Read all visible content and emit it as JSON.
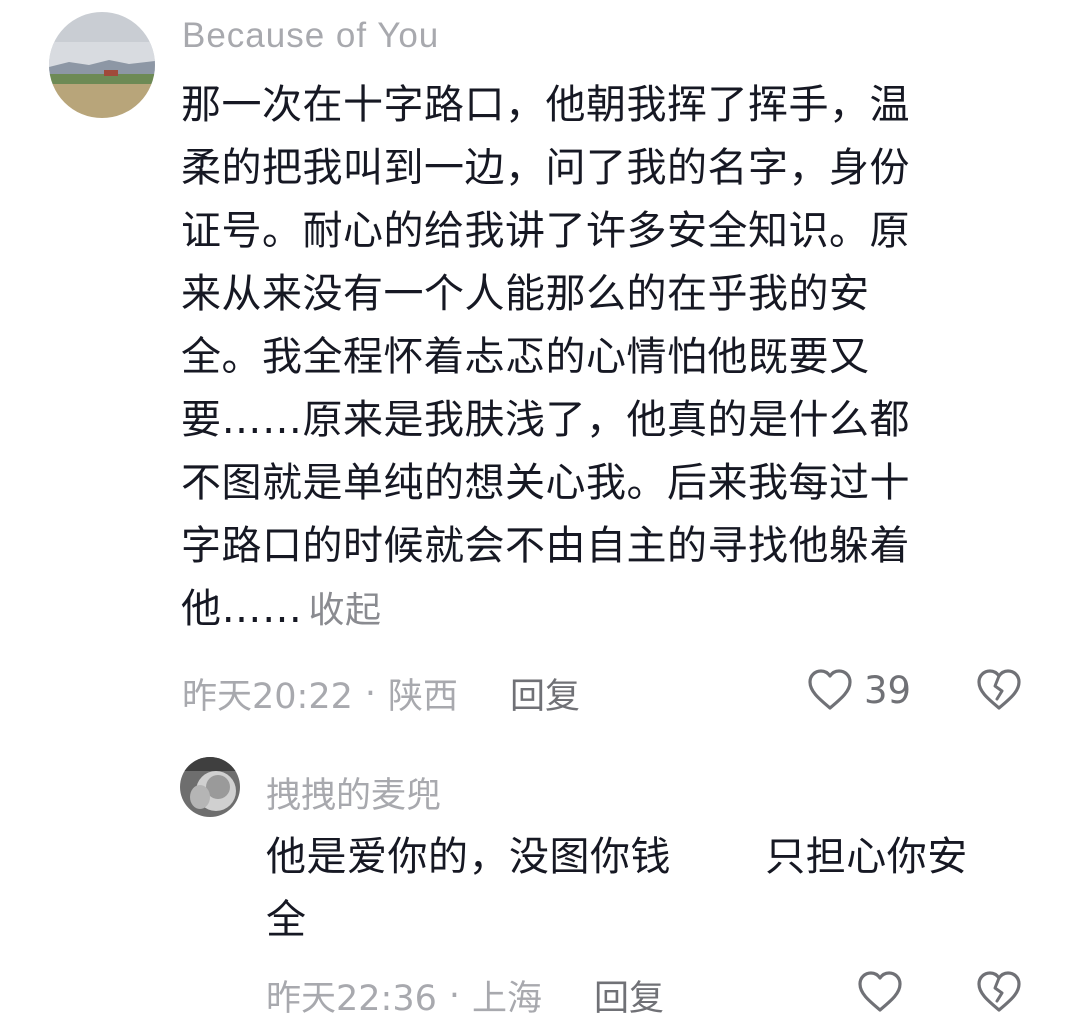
{
  "comments": [
    {
      "username": "Because  of  You",
      "lines": [
        "那一次在十字路口，他朝我挥了挥手，温",
        "柔的把我叫到一边，问了我的名字，身份",
        "证号。耐心的给我讲了许多安全知识。原",
        "来从来没有一个人能那么的在乎我的安",
        "全。我全程怀着忐忑的心情怕他既要又",
        "要……原来是我肤浅了，他真的是什么都",
        "不图就是单纯的想关心我。后来我每过十",
        "字路口的时候就会不由自主的寻找他躲着",
        "他……"
      ],
      "collapse_label": "收起",
      "time": "昨天20:22",
      "separator": "·",
      "location": "陕西",
      "reply_label": "回复",
      "like_count": "39",
      "like_icon": "heart-outline-icon",
      "dislike_icon": "broken-heart-icon"
    },
    {
      "username": "拽拽的麦兜",
      "lines": [
        "他是爱你的，没图你钱　　 只担心你安",
        "全"
      ],
      "time": "昨天22:36",
      "separator": "·",
      "location": "上海",
      "reply_label": "回复",
      "like_icon": "heart-outline-icon",
      "dislike_icon": "broken-heart-icon"
    }
  ],
  "colors": {
    "text": "#161823",
    "secondary": "#a8a9ae",
    "action": "#707176"
  }
}
